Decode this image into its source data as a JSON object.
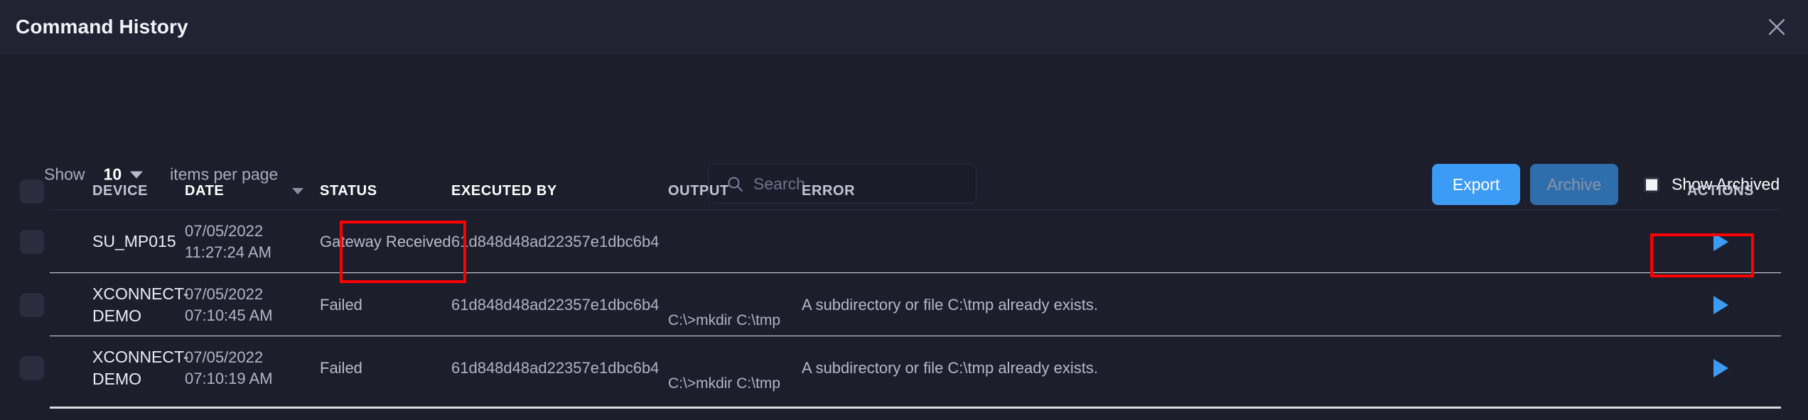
{
  "window": {
    "title": "Command History",
    "close_icon": "close-icon"
  },
  "toolbar": {
    "show_label": "Show",
    "page_size": "10",
    "items_per_page_label": "items per page",
    "search_placeholder": "Search",
    "search_value": "",
    "search_icon": "search-icon",
    "export_label": "Export",
    "archive_label": "Archive",
    "show_archived_label": "Show Archived",
    "show_archived_checked": false
  },
  "table": {
    "headers": {
      "device": "DEVICE",
      "date": "DATE",
      "status": "STATUS",
      "executed_by": "EXECUTED BY",
      "output": "OUTPUT",
      "error": "ERROR",
      "actions": "ACTIONS"
    },
    "sort_column": "DATE",
    "sort_direction": "desc",
    "rows": [
      {
        "device": "SU_MP015",
        "date": "07/05/2022",
        "time": "11:27:24 AM",
        "status": "Gateway Received",
        "executed_by": "61d848d48ad22357e1dbc6b4",
        "output": "",
        "error": "",
        "action_icon": "play-icon"
      },
      {
        "device": "XCONNECT-DEMO",
        "date": "07/05/2022",
        "time": "07:10:45 AM",
        "status": "Failed",
        "executed_by": "61d848d48ad22357e1dbc6b4",
        "output": "C:\\>mkdir C:\\tmp",
        "error": "A subdirectory or file C:\\tmp already exists.",
        "action_icon": "play-icon"
      },
      {
        "device": "XCONNECT-DEMO",
        "date": "07/05/2022",
        "time": "07:10:19 AM",
        "status": "Failed",
        "executed_by": "61d848d48ad22357e1dbc6b4",
        "output": "C:\\>mkdir C:\\tmp",
        "error": "A subdirectory or file C:\\tmp already exists.",
        "action_icon": "play-icon"
      }
    ]
  },
  "colors": {
    "background": "#1d1e2c",
    "header_background": "#212232",
    "accent_blue": "#3c9bf5",
    "archive_blue": "#2f6ead",
    "annotation_red": "#ff0000"
  }
}
